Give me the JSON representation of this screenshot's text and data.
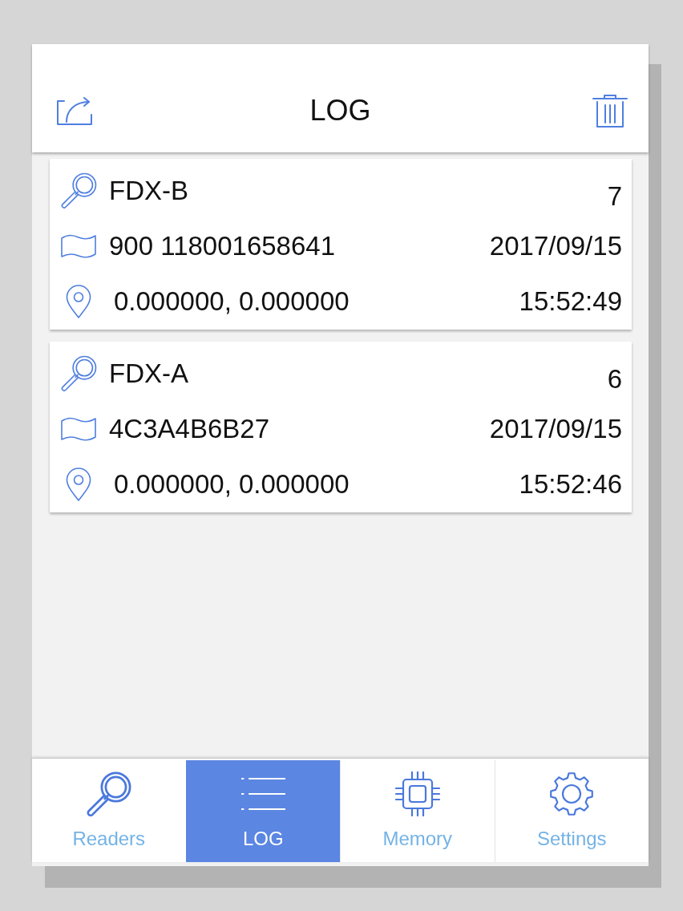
{
  "header": {
    "title": "LOG"
  },
  "entries": [
    {
      "tag_type": "FDX-B",
      "count": "7",
      "tag_id": "900 118001658641",
      "date": "2017/09/15",
      "coordinates": "0.000000, 0.000000",
      "time": "15:52:49"
    },
    {
      "tag_type": "FDX-A",
      "count": "6",
      "tag_id": "4C3A4B6B27",
      "date": "2017/09/15",
      "coordinates": "0.000000, 0.000000",
      "time": "15:52:46"
    }
  ],
  "tab_bar": {
    "tabs": [
      {
        "label": "Readers",
        "kind": "readers",
        "selected": false
      },
      {
        "label": "LOG",
        "kind": "log",
        "selected": true
      },
      {
        "label": "Memory",
        "kind": "memory",
        "selected": false
      },
      {
        "label": "Settings",
        "kind": "settings",
        "selected": false
      }
    ]
  }
}
